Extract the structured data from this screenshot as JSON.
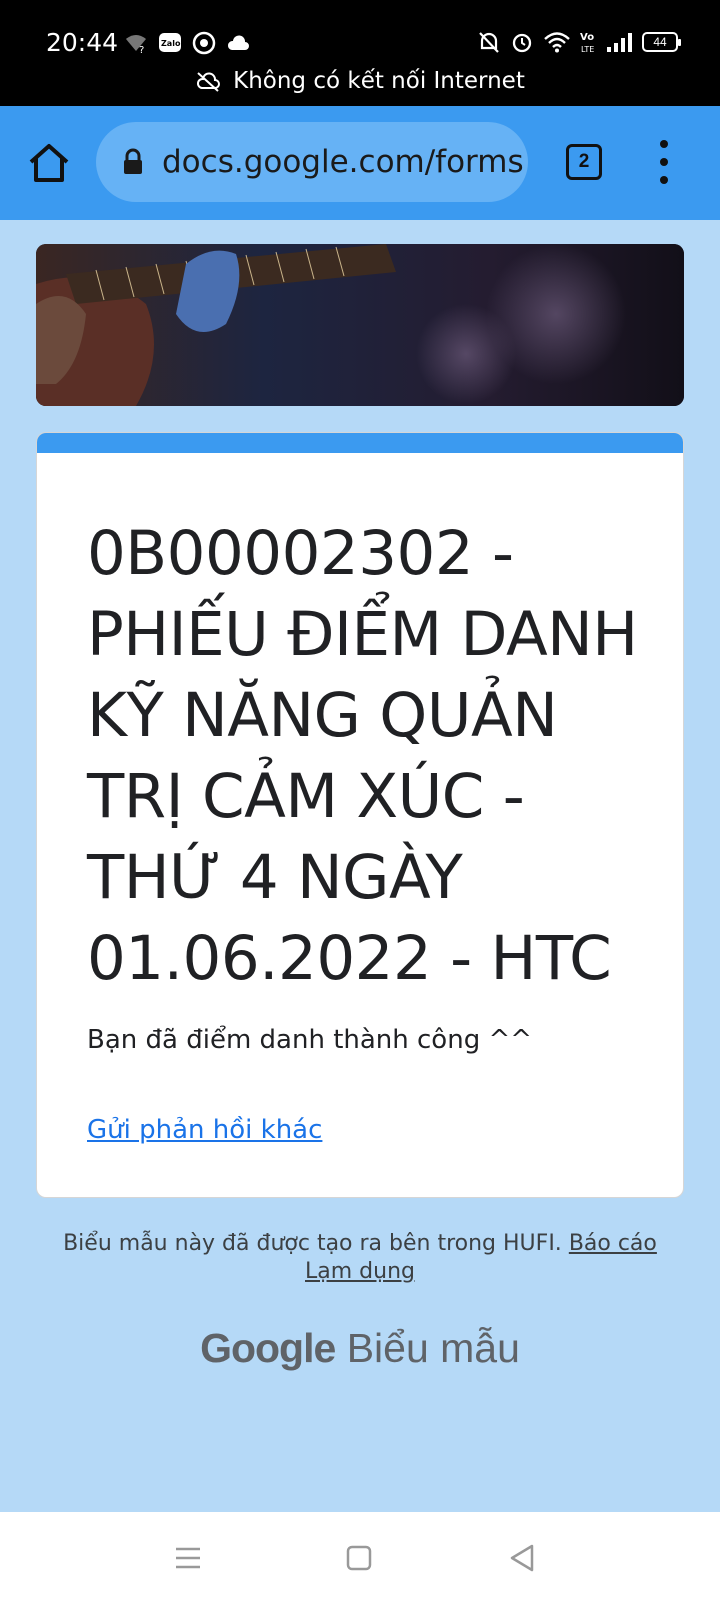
{
  "status_bar": {
    "time": "20:44",
    "battery": "44",
    "network_notice": "Không có kết nối Internet",
    "icons": [
      "wifi-unknown-icon",
      "zalo-icon",
      "compass-icon",
      "cloud-icon",
      "mute-icon",
      "alarm-icon",
      "wifi-icon",
      "volte-icon",
      "signal-icon",
      "battery-icon"
    ]
  },
  "browser": {
    "url": "docs.google.com/forms",
    "tab_count": "2",
    "icons": [
      "home-icon",
      "lock-icon",
      "tabs-icon",
      "more-vert-icon"
    ]
  },
  "form": {
    "title": "0B00002302 - PHIẾU ĐIỂM DANH KỸ NĂNG QUẢN TRỊ CẢM XÚC - THỨ 4 NGÀY 01.06.2022 - HTC",
    "confirmation": "Bạn đã điểm danh thành công ^^",
    "resubmit_link": "Gửi phản hồi khác",
    "accent_color": "#3b9af0"
  },
  "footer": {
    "note": "Biểu mẫu này đã được tạo ra bên trong HUFI.",
    "report_link": "Báo cáo Lạm dụng",
    "brand_google": "Google",
    "brand_forms": "Biểu mẫu"
  },
  "nav": {
    "icons": [
      "recents-icon",
      "home-square-icon",
      "back-icon"
    ]
  }
}
